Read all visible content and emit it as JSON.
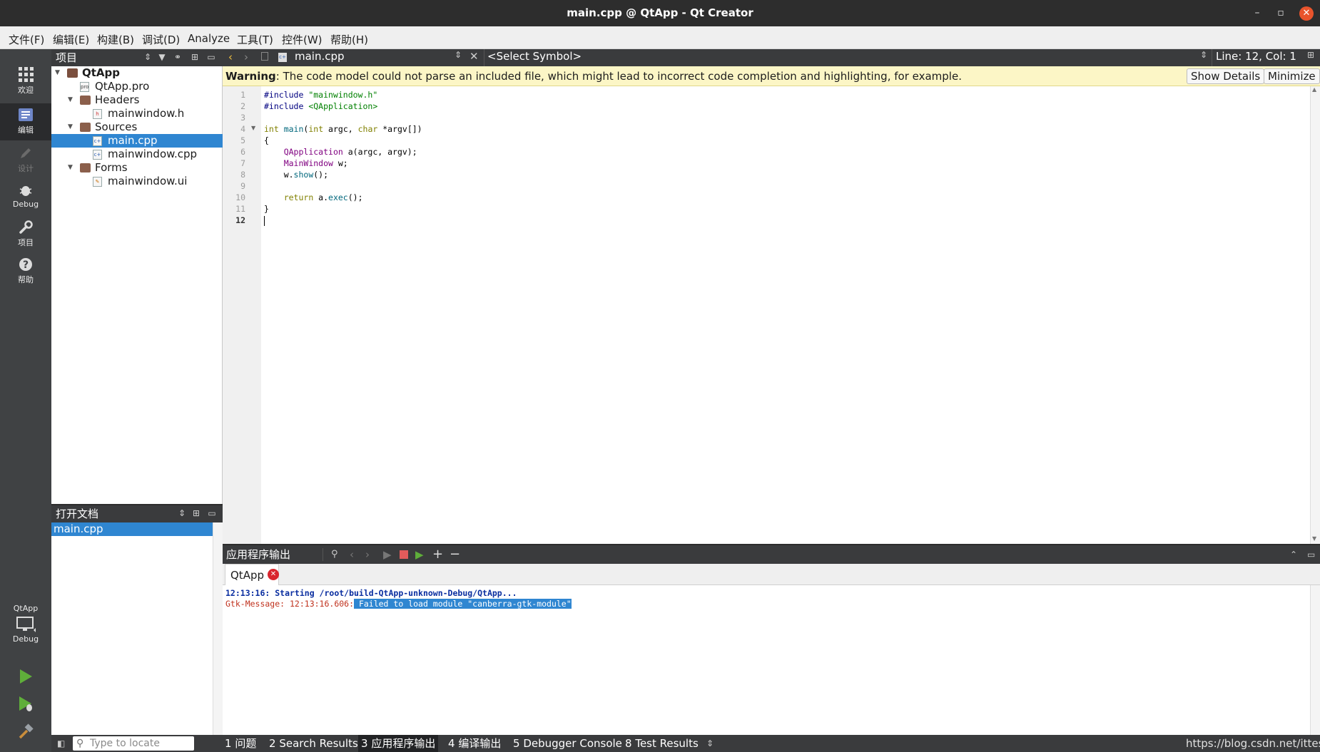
{
  "window": {
    "title": "main.cpp @ QtApp - Qt Creator",
    "minimize": "–",
    "maximize": "▫",
    "close": "✕"
  },
  "menu": [
    "文件(F)",
    "编辑(E)",
    "构建(B)",
    "调试(D)",
    "Analyze",
    "工具(T)",
    "控件(W)",
    "帮助(H)"
  ],
  "modes": {
    "welcome": "欢迎",
    "edit": "编辑",
    "design": "设计",
    "debug": "Debug",
    "projects": "项目",
    "help": "帮助"
  },
  "kit": {
    "project": "QtApp",
    "config": "Debug"
  },
  "project_panel": {
    "title": "项目",
    "tree": [
      {
        "label": "QtApp",
        "level": 0,
        "kind": "project",
        "expanded": true
      },
      {
        "label": "QtApp.pro",
        "level": 1,
        "kind": "pro-file"
      },
      {
        "label": "Headers",
        "level": 1,
        "kind": "folder",
        "expanded": true
      },
      {
        "label": "mainwindow.h",
        "level": 2,
        "kind": "header-file"
      },
      {
        "label": "Sources",
        "level": 1,
        "kind": "folder",
        "expanded": true
      },
      {
        "label": "main.cpp",
        "level": 2,
        "kind": "cpp-file",
        "selected": true
      },
      {
        "label": "mainwindow.cpp",
        "level": 2,
        "kind": "cpp-file"
      },
      {
        "label": "Forms",
        "level": 1,
        "kind": "folder",
        "expanded": true
      },
      {
        "label": "mainwindow.ui",
        "level": 2,
        "kind": "ui-file"
      }
    ]
  },
  "open_docs": {
    "title": "打开文档",
    "items": [
      "main.cpp"
    ]
  },
  "editor": {
    "file": "main.cpp",
    "symbol": "<Select Symbol>",
    "position": "Line: 12, Col: 1",
    "warning_label": "Warning",
    "warning_text": ": The code model could not parse an included file, which might lead to incorrect code completion and highlighting, for example.",
    "show_details": "Show Details",
    "minimize": "Minimize",
    "current_line": 12,
    "lines": [
      [
        [
          "pr",
          "#include "
        ],
        [
          "str",
          "\"mainwindow.h\""
        ]
      ],
      [
        [
          "pr",
          "#include "
        ],
        [
          "str",
          "<QApplication>"
        ]
      ],
      [],
      [
        [
          "kw",
          "int "
        ],
        [
          "fn",
          "main"
        ],
        [
          "",
          "("
        ],
        [
          "kw",
          "int "
        ],
        [
          "",
          "argc, "
        ],
        [
          "kw",
          "char "
        ],
        [
          "",
          "*argv[])"
        ]
      ],
      [
        [
          "",
          "{"
        ]
      ],
      [
        [
          "",
          "    "
        ],
        [
          "ty",
          "QApplication "
        ],
        [
          "",
          "a(argc, argv);"
        ]
      ],
      [
        [
          "",
          "    "
        ],
        [
          "ty",
          "MainWindow "
        ],
        [
          "",
          "w;"
        ]
      ],
      [
        [
          "",
          "    w."
        ],
        [
          "fn",
          "show"
        ],
        [
          "",
          "();"
        ]
      ],
      [],
      [
        [
          "",
          "    "
        ],
        [
          "kw",
          "return "
        ],
        [
          "",
          "a."
        ],
        [
          "fn",
          "exec"
        ],
        [
          "",
          "();"
        ]
      ],
      [
        [
          "",
          "}"
        ]
      ],
      []
    ]
  },
  "output": {
    "title": "应用程序输出",
    "tab": "QtApp",
    "line1": "12:13:16: Starting /root/build-QtApp-unknown-Debug/QtApp...",
    "line2_prefix": "Gtk-Message: 12:13:16.606:",
    "line2_selected": " Failed to load module \"canberra-gtk-module\""
  },
  "statusbar": {
    "locator_placeholder": "Type to locate (Ctrl...",
    "tabs": [
      {
        "num": "1",
        "label": "问题"
      },
      {
        "num": "2",
        "label": "Search Results"
      },
      {
        "num": "3",
        "label": "应用程序输出",
        "active": true
      },
      {
        "num": "4",
        "label": "编译输出"
      },
      {
        "num": "5",
        "label": "Debugger Console"
      },
      {
        "num": "8",
        "label": "Test Results"
      }
    ],
    "watermark": "https://blog.csdn.net/ittest"
  }
}
